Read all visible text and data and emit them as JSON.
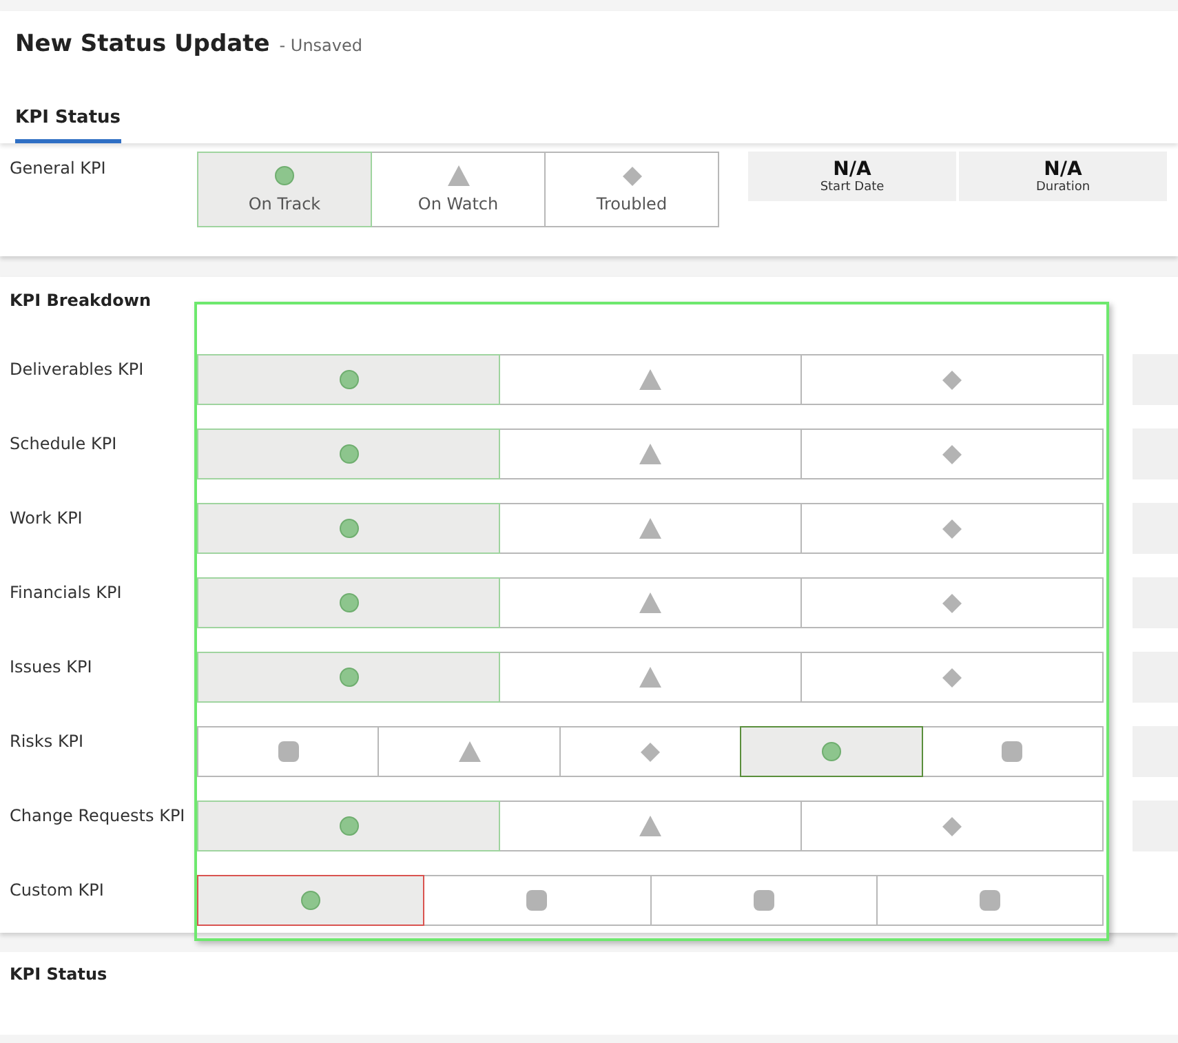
{
  "title": "New Status Update",
  "subtitle": "- Unsaved",
  "tabs": [
    {
      "label": "KPI Status",
      "selected": true
    }
  ],
  "general": {
    "label": "General KPI",
    "options": [
      {
        "kind": "circle",
        "label": "On Track",
        "selected": true,
        "color": "#9fd49f"
      },
      {
        "kind": "triangle",
        "label": "On Watch",
        "selected": false
      },
      {
        "kind": "diamond",
        "label": "Troubled",
        "selected": false
      }
    ],
    "stats": [
      {
        "value": "N/A",
        "label": "Start Date"
      },
      {
        "value": "N/A",
        "label": "Duration"
      }
    ]
  },
  "breakdown": {
    "title": "KPI Breakdown",
    "rows": [
      {
        "label": "Deliverables KPI",
        "side_block": true,
        "options": [
          {
            "kind": "circle",
            "selected": true,
            "color": "#9fd49f"
          },
          {
            "kind": "triangle",
            "selected": false
          },
          {
            "kind": "diamond",
            "selected": false
          }
        ]
      },
      {
        "label": "Schedule KPI",
        "side_block": true,
        "options": [
          {
            "kind": "circle",
            "selected": true,
            "color": "#9fd49f"
          },
          {
            "kind": "triangle",
            "selected": false
          },
          {
            "kind": "diamond",
            "selected": false
          }
        ]
      },
      {
        "label": "Work KPI",
        "side_block": true,
        "options": [
          {
            "kind": "circle",
            "selected": true,
            "color": "#9fd49f"
          },
          {
            "kind": "triangle",
            "selected": false
          },
          {
            "kind": "diamond",
            "selected": false
          }
        ]
      },
      {
        "label": "Financials KPI",
        "side_block": true,
        "options": [
          {
            "kind": "circle",
            "selected": true,
            "color": "#9fd49f"
          },
          {
            "kind": "triangle",
            "selected": false
          },
          {
            "kind": "diamond",
            "selected": false
          }
        ]
      },
      {
        "label": "Issues KPI",
        "side_block": true,
        "options": [
          {
            "kind": "circle",
            "selected": true,
            "color": "#9fd49f"
          },
          {
            "kind": "triangle",
            "selected": false
          },
          {
            "kind": "diamond",
            "selected": false
          }
        ]
      },
      {
        "label": "Risks KPI",
        "side_block": true,
        "options": [
          {
            "kind": "square",
            "selected": false
          },
          {
            "kind": "triangle",
            "selected": false
          },
          {
            "kind": "diamond",
            "selected": false
          },
          {
            "kind": "circle",
            "selected": true,
            "color": "#5a8f3c"
          },
          {
            "kind": "square",
            "selected": false
          }
        ]
      },
      {
        "label": "Change Requests KPI",
        "side_block": true,
        "options": [
          {
            "kind": "circle",
            "selected": true,
            "color": "#9fd49f"
          },
          {
            "kind": "triangle",
            "selected": false
          },
          {
            "kind": "diamond",
            "selected": false
          }
        ]
      },
      {
        "label": "Custom KPI",
        "side_block": false,
        "options": [
          {
            "kind": "circle",
            "selected": true,
            "color": "#d9534f"
          },
          {
            "kind": "square",
            "selected": false
          },
          {
            "kind": "square",
            "selected": false
          },
          {
            "kind": "square",
            "selected": false
          }
        ]
      }
    ]
  },
  "footer_section": {
    "title": "KPI Status"
  }
}
